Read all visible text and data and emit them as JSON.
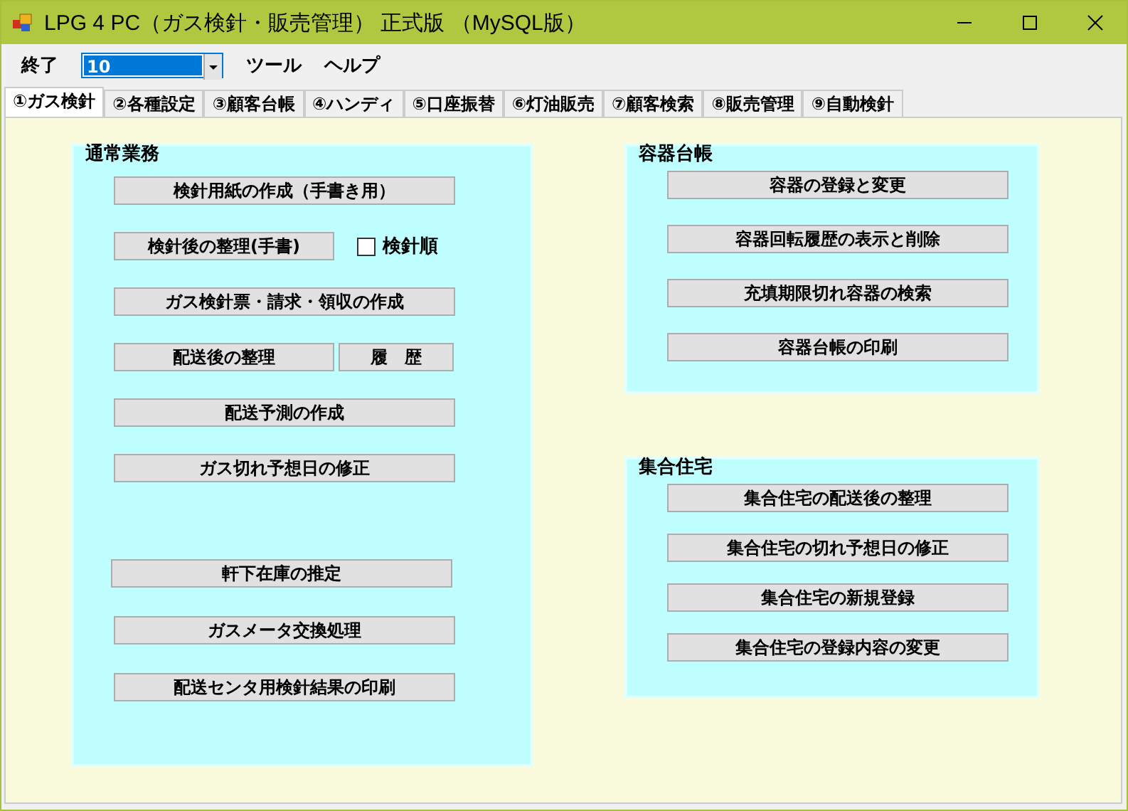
{
  "window": {
    "title": "LPG 4 PC（ガス検針・販売管理） 正式版 （MySQL版）"
  },
  "menu": {
    "items": [
      {
        "kind": "menu",
        "label": "終了"
      },
      {
        "kind": "combo",
        "value": "10"
      },
      {
        "kind": "menu",
        "label": "ツール"
      },
      {
        "kind": "menu",
        "label": "ヘルプ"
      }
    ]
  },
  "tabs": [
    {
      "label": "①ガス検針",
      "selected": true
    },
    {
      "label": "②各種設定",
      "selected": false
    },
    {
      "label": "③顧客台帳",
      "selected": false
    },
    {
      "label": "④ハンディ",
      "selected": false
    },
    {
      "label": "⑤口座振替",
      "selected": false
    },
    {
      "label": "⑥灯油販売",
      "selected": false
    },
    {
      "label": "⑦顧客検索",
      "selected": false
    },
    {
      "label": "⑧販売管理",
      "selected": false
    },
    {
      "label": "⑨自動検針",
      "selected": false
    }
  ],
  "groups": [
    {
      "title": "通常業務",
      "items": [
        {
          "kind": "button",
          "label": "検針用紙の作成（手書き用）"
        },
        {
          "kind": "button_check",
          "label": "検針後の整理(手書)",
          "check_label": "検針順",
          "checked": false
        },
        {
          "kind": "button",
          "label": "ガス検針票・請求・領収の作成"
        },
        {
          "kind": "button_pair",
          "label": "配送後の整理",
          "second_label": "履　歴"
        },
        {
          "kind": "button",
          "label": "配送予測の作成"
        },
        {
          "kind": "button",
          "label": "ガス切れ予想日の修正"
        },
        {
          "kind": "button",
          "label": "軒下在庫の推定"
        },
        {
          "kind": "button",
          "label": "ガスメータ交換処理"
        },
        {
          "kind": "button",
          "label": "配送センタ用検針結果の印刷"
        }
      ]
    },
    {
      "title": "容器台帳",
      "items": [
        {
          "kind": "button",
          "label": "容器の登録と変更"
        },
        {
          "kind": "button",
          "label": "容器回転履歴の表示と削除"
        },
        {
          "kind": "button",
          "label": "充填期限切れ容器の検索"
        },
        {
          "kind": "button",
          "label": "容器台帳の印刷"
        }
      ]
    },
    {
      "title": "集合住宅",
      "items": [
        {
          "kind": "button",
          "label": "集合住宅の配送後の整理"
        },
        {
          "kind": "button",
          "label": "集合住宅の切れ予想日の修正"
        },
        {
          "kind": "button",
          "label": "集合住宅の新規登録"
        },
        {
          "kind": "button",
          "label": "集合住宅の登録内容の変更"
        }
      ]
    }
  ]
}
